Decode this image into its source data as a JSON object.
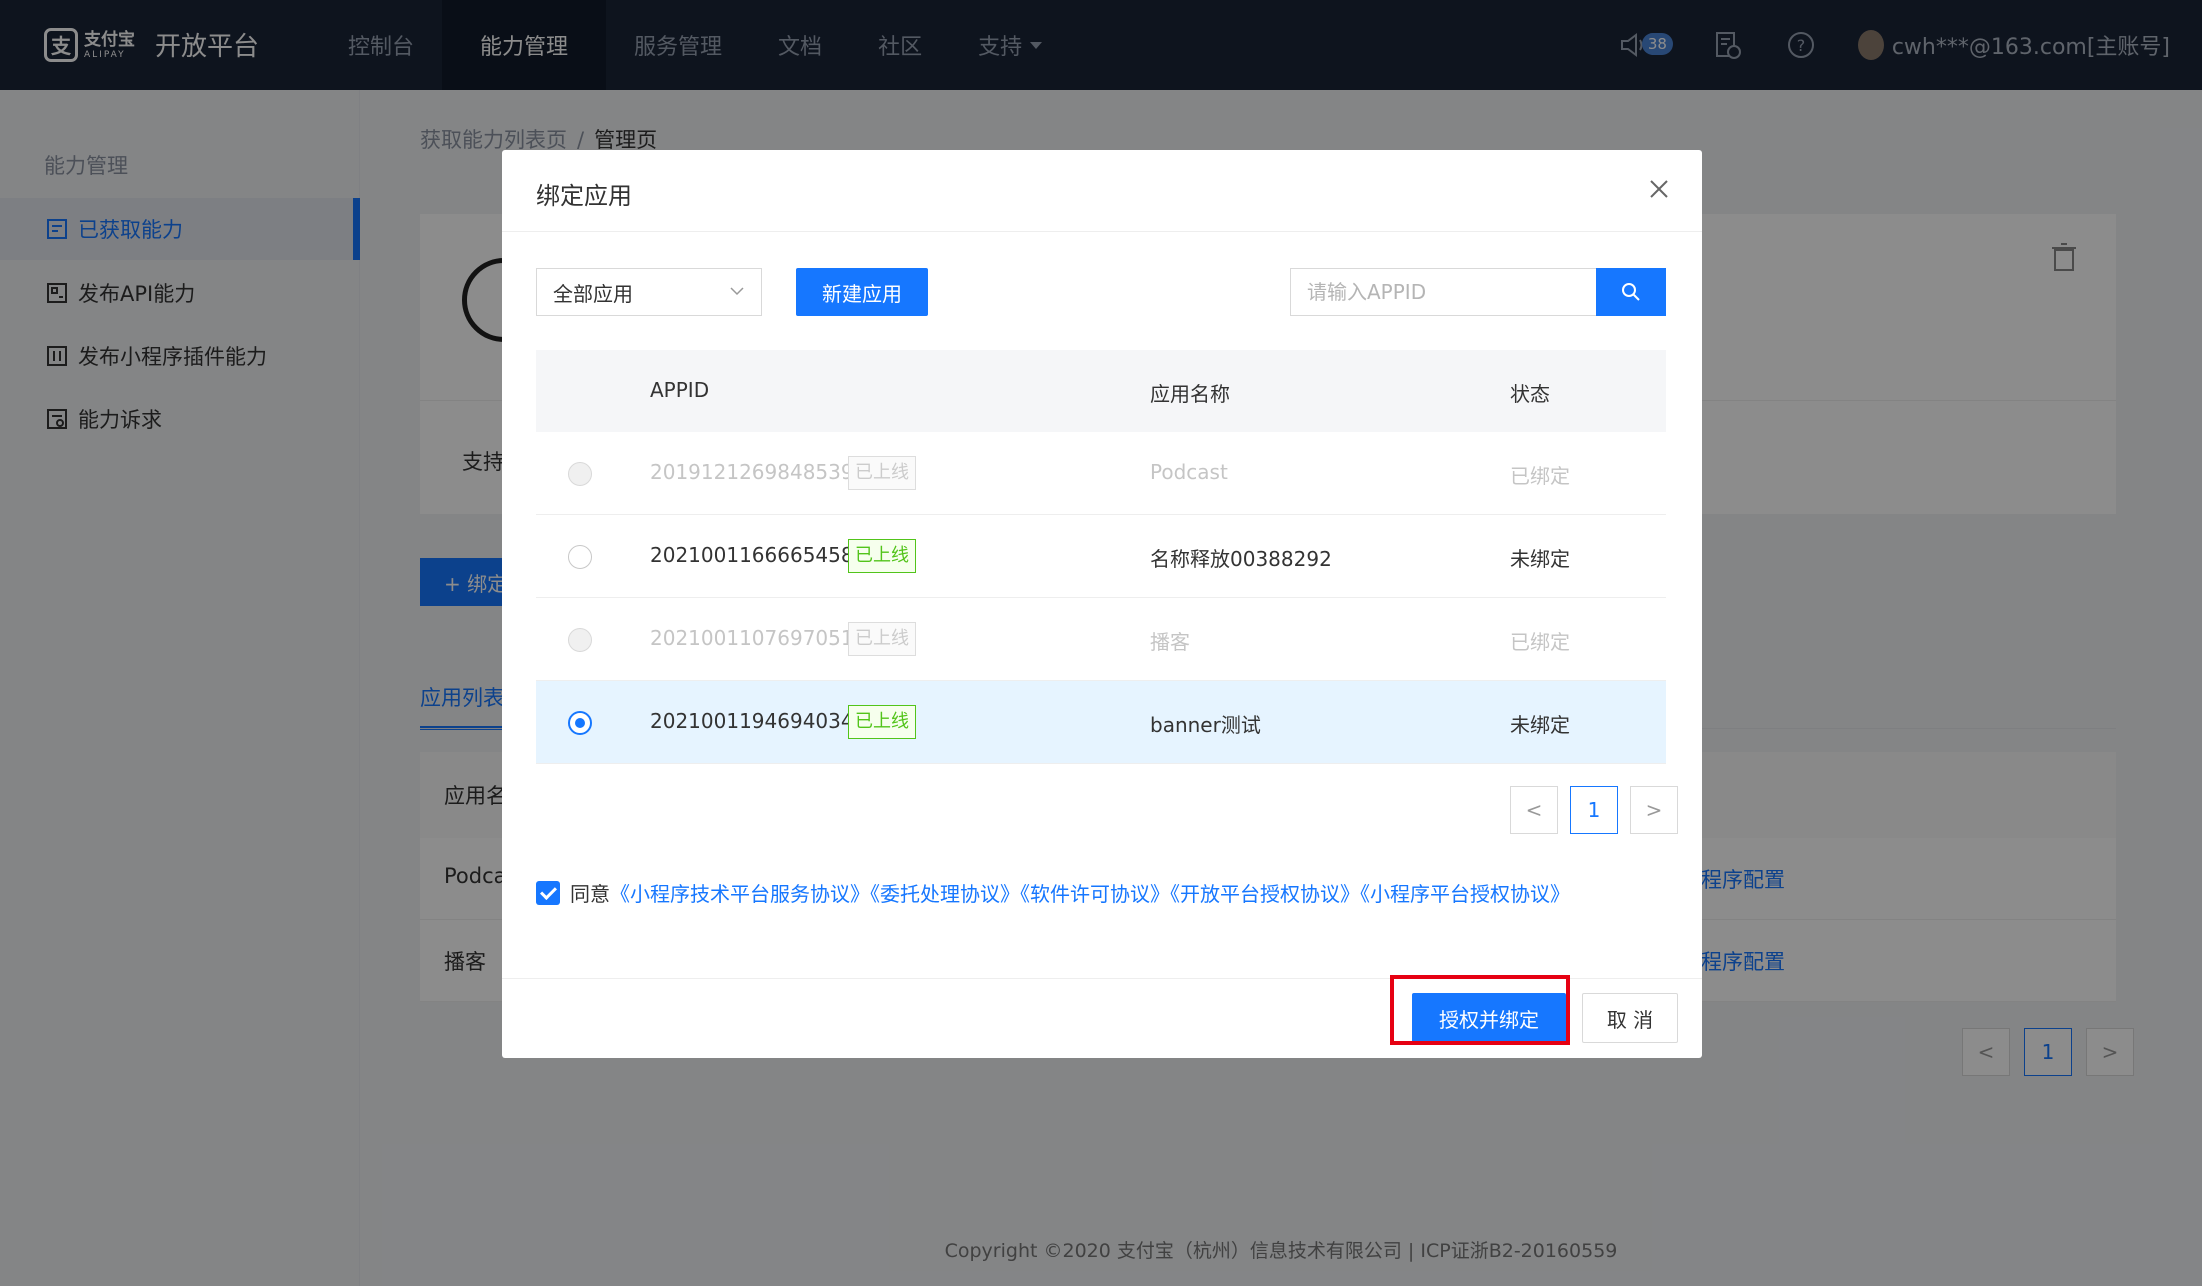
{
  "nav": {
    "logo_cn": "支付宝",
    "logo_en": "ALIPAY",
    "platform_title": "开放平台",
    "items": [
      {
        "label": "控制台"
      },
      {
        "label": "能力管理"
      },
      {
        "label": "服务管理"
      },
      {
        "label": "文档"
      },
      {
        "label": "社区"
      },
      {
        "label": "支持"
      }
    ],
    "notification_count": "38",
    "user": "cwh***@163.com[主账号]"
  },
  "sidebar": {
    "heading": "能力管理",
    "items": [
      {
        "label": "已获取能力",
        "icon": "acquired-icon"
      },
      {
        "label": "发布API能力",
        "icon": "api-icon"
      },
      {
        "label": "发布小程序插件能力",
        "icon": "plugin-icon"
      },
      {
        "label": "能力诉求",
        "icon": "request-icon"
      }
    ]
  },
  "breadcrumb": {
    "parent": "获取能力列表页",
    "separator": "/",
    "current": "管理页"
  },
  "page": {
    "support_label": "支持",
    "bind_button": "+ 绑定",
    "tab_label": "应用列表",
    "table_header": "应用名",
    "rows": [
      {
        "name": "Podca",
        "config": "小程序配置"
      },
      {
        "name": "播客",
        "config": "小程序配置"
      }
    ],
    "pager": {
      "prev": "<",
      "current": "1",
      "next": ">"
    }
  },
  "modal": {
    "title": "绑定应用",
    "filter_select": "全部应用",
    "new_app_button": "新建应用",
    "search_placeholder": "请输入APPID",
    "columns": {
      "appid": "APPID",
      "name": "应用名称",
      "status": "状态"
    },
    "rows": [
      {
        "appid": "2019121269848539",
        "tag": "已上线",
        "name": "Podcast",
        "status": "已绑定",
        "disabled": true,
        "selected": false
      },
      {
        "appid": "2021001166665458",
        "tag": "已上线",
        "name": "名称释放00388292",
        "status": "未绑定",
        "disabled": false,
        "selected": false
      },
      {
        "appid": "2021001107697051",
        "tag": "已上线",
        "name": "播客",
        "status": "已绑定",
        "disabled": true,
        "selected": false
      },
      {
        "appid": "2021001194694034",
        "tag": "已上线",
        "name": "banner测试",
        "status": "未绑定",
        "disabled": false,
        "selected": true
      }
    ],
    "pager": {
      "prev": "<",
      "current": "1",
      "next": ">"
    },
    "agree_prefix": "同意",
    "agreements": [
      "《小程序技术平台服务协议》",
      "《委托处理协议》",
      "《软件许可协议》",
      "《开放平台授权协议》",
      "《小程序平台授权协议》"
    ],
    "auth_button": "授权并绑定",
    "cancel_button": "取 消"
  },
  "footer": "Copyright ©2020 支付宝（杭州）信息技术有限公司 | ICP证浙B2-20160559",
  "colors": {
    "primary": "#1677ff",
    "nav_bg": "#1b2538",
    "highlight": "#e60012",
    "tag_green": "#52c41a"
  }
}
